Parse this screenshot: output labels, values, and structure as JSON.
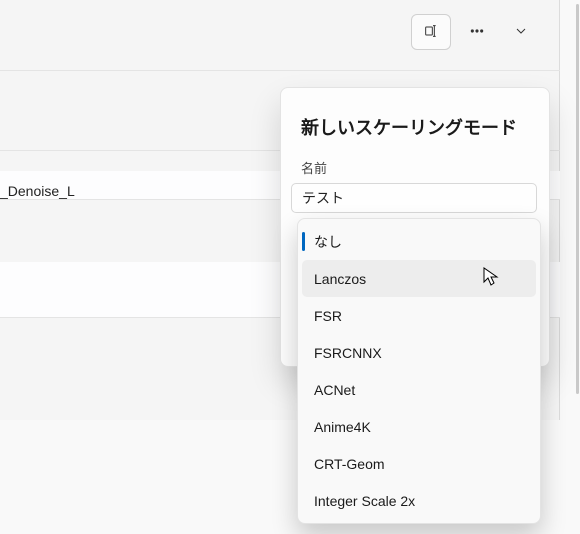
{
  "toolbar": {
    "rename_btn": "rename",
    "more_btn": "more",
    "expand_btn": "expand"
  },
  "background": {
    "row1_text": "_Denoise_L"
  },
  "dialog": {
    "title": "新しいスケーリングモード",
    "name_label": "名前",
    "name_value": "テスト"
  },
  "dropdown": {
    "items": [
      "なし",
      "Lanczos",
      "FSR",
      "FSRCNNX",
      "ACNet",
      "Anime4K",
      "CRT-Geom",
      "Integer Scale 2x"
    ],
    "selected_index": 0,
    "hover_index": 1
  }
}
